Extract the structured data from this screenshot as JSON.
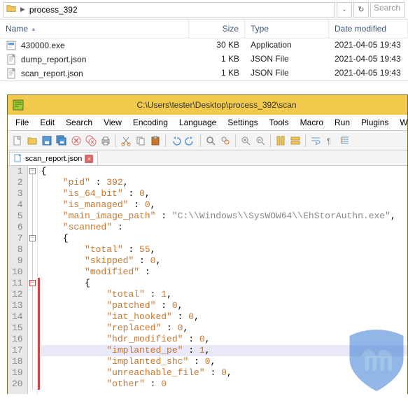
{
  "explorer": {
    "path_segments": [
      "process_392"
    ],
    "search_placeholder": "Search",
    "columns": {
      "name": "Name",
      "size": "Size",
      "type": "Type",
      "date": "Date modified"
    },
    "files": [
      {
        "icon": "exe",
        "name": "430000.exe",
        "size": "30 KB",
        "type": "Application",
        "date": "2021-04-05 19:43"
      },
      {
        "icon": "json",
        "name": "dump_report.json",
        "size": "1 KB",
        "type": "JSON File",
        "date": "2021-04-05 19:43"
      },
      {
        "icon": "json",
        "name": "scan_report.json",
        "size": "1 KB",
        "type": "JSON File",
        "date": "2021-04-05 19:43"
      }
    ]
  },
  "npp": {
    "title": "C:\\Users\\tester\\Desktop\\process_392\\scan",
    "menu": [
      "File",
      "Edit",
      "Search",
      "View",
      "Encoding",
      "Language",
      "Settings",
      "Tools",
      "Macro",
      "Run",
      "Plugins",
      "Window"
    ],
    "tab": {
      "label": "scan_report.json"
    },
    "code": {
      "pid": 392,
      "is_64_bit": 0,
      "is_managed": 0,
      "main_image_path": "C:\\\\Windows\\\\SysWOW64\\\\EhStorAuthn.exe",
      "scanned": {
        "total": 55,
        "skipped": 0,
        "modified": {
          "total": 1,
          "patched": 0,
          "iat_hooked": 0,
          "replaced": 0,
          "hdr_modified": 0,
          "implanted_pe": 1,
          "implanted_shc": 0,
          "unreachable_file": 0,
          "other": 0
        }
      }
    },
    "highlighted_line": 17
  }
}
